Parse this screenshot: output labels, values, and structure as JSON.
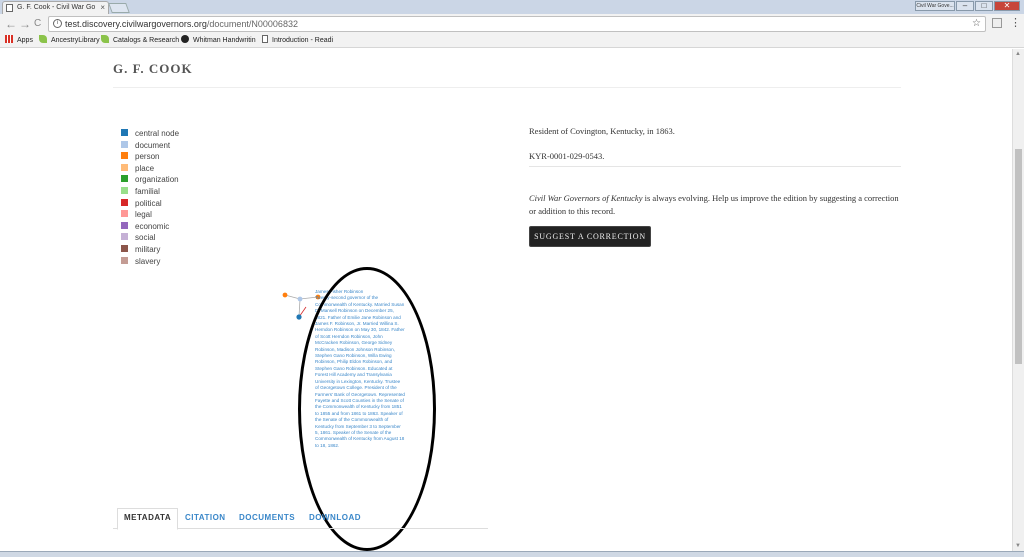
{
  "browser": {
    "tab_title": "G. F. Cook - Civil War Go",
    "tab_close": "×",
    "window_label": "Civil War Gove...",
    "url_host": "test.discovery.civilwargovernors.org",
    "url_path": "/document/N00006832",
    "info_glyph": "i",
    "back_glyph": "←",
    "forward_glyph": "→",
    "reload_glyph": "C",
    "star_glyph": "☆",
    "menu_glyph": "⋮",
    "minimize_glyph": "–",
    "maximize_glyph": "□",
    "close_glyph": "✕",
    "bookmarks": [
      {
        "label": "Apps",
        "icon": "apps-grid-icon",
        "color": "#d93025"
      },
      {
        "label": "AncestryLibrary",
        "icon": "leaf-icon",
        "color": "#8bc34a"
      },
      {
        "label": "Catalogs & Research",
        "icon": "leaf-icon",
        "color": "#8bc34a"
      },
      {
        "label": "Whitman Handwritin",
        "icon": "github-icon",
        "color": "#222222"
      },
      {
        "label": "Introduction - Readi",
        "icon": "page-icon",
        "color": "#ffffff"
      }
    ]
  },
  "page": {
    "title": "G. F. COOK",
    "resident": "Resident of Covington, Kentucky, in 1863.",
    "record_id": "KYR-0001-029-0543.",
    "notice_edition": "Civil War Governors of Kentucky",
    "notice_rest": " is always evolving. Help us improve the edition by suggesting a correction or addition to this record.",
    "suggest_button": "SUGGEST A CORRECTION",
    "tooltip": "James Fisher Robinson\nTwenty-second governor of the Commonwealth of Kentucky. Married Susan D. Mansell Robinson on December 25, 1821. Father of Emilie Jane Robinson and James F. Robinson, Jr. Married Willina S. Herndon Robinson on May 30, 1842. Father of Scott Herndon Robinson, John McCracken Robinson, George Sidney Robinson, Madison Johnson Robinson, Stephen Gano Robinson, Willa Ewing Robinson, Philip Eldon Robinson, and Stephen Gano Robinson. Educated at Forest Hill Academy and Transylvania University in Lexington, Kentucky. Trustee of Georgetown College. President of the Farmers' Bank of Georgetown. Represented Fayette and Scott Counties in the Senate of the Commonwealth of Kentucky from 1851 to 1855 and from 1861 to 1863. Speaker of the Senate of the Commonwealth of Kentucky from September 3 to September 5, 1861. Speaker of the Senate of the Commonwealth of Kentucky from August 18 to 18, 1862.",
    "tabs": [
      "METADATA",
      "CITATION",
      "DOCUMENTS",
      "DOWNLOAD"
    ]
  },
  "legend": [
    {
      "label": "central node",
      "color": "#1f77b4"
    },
    {
      "label": "document",
      "color": "#aec7e8"
    },
    {
      "label": "person",
      "color": "#ff7f0e"
    },
    {
      "label": "place",
      "color": "#ffbb78"
    },
    {
      "label": "organization",
      "color": "#2ca02c"
    },
    {
      "label": "familial",
      "color": "#98df8a"
    },
    {
      "label": "political",
      "color": "#d62728"
    },
    {
      "label": "legal",
      "color": "#ff9896"
    },
    {
      "label": "economic",
      "color": "#9467bd"
    },
    {
      "label": "social",
      "color": "#c5b0d5"
    },
    {
      "label": "military",
      "color": "#8c564b"
    },
    {
      "label": "slavery",
      "color": "#c49c94"
    }
  ]
}
